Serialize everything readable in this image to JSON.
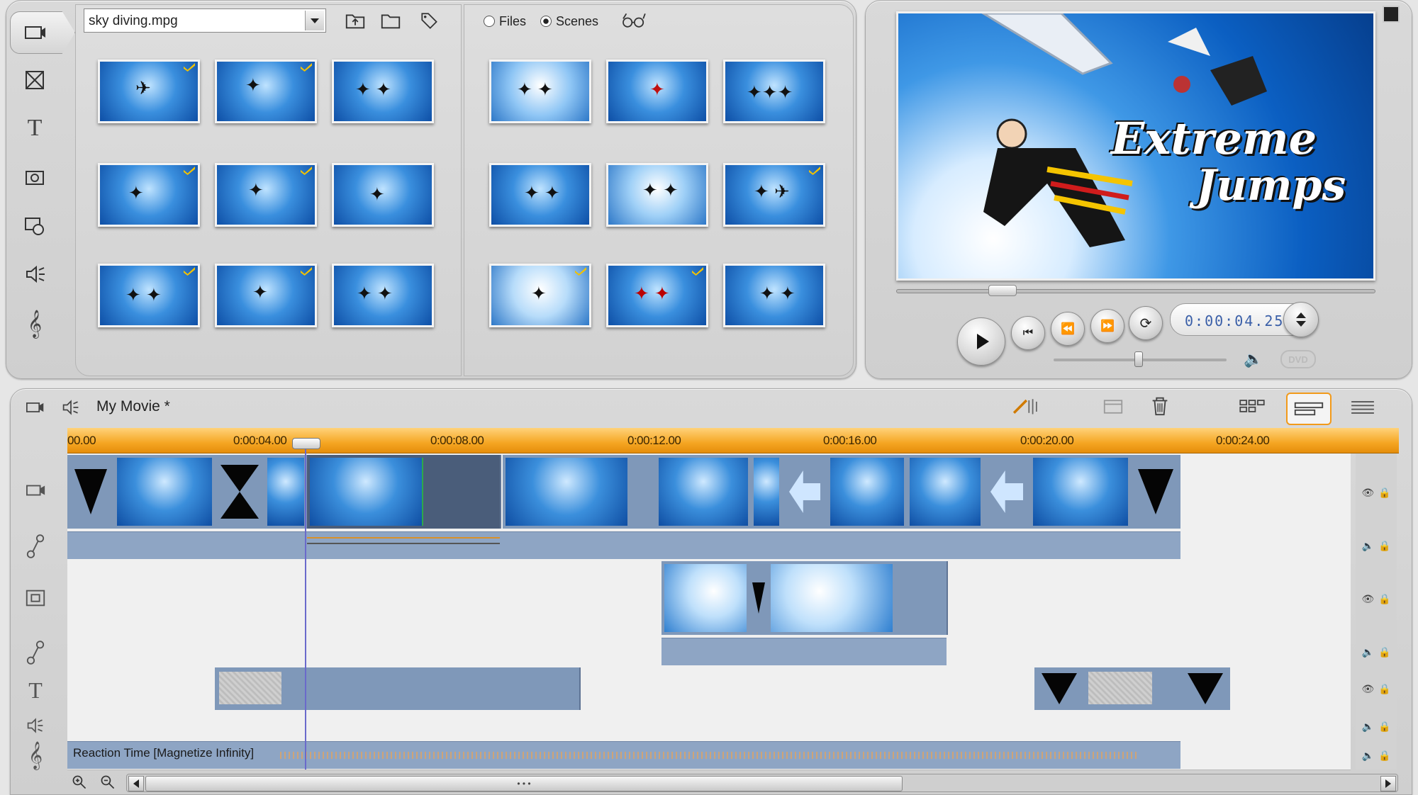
{
  "library": {
    "file_dropdown": "sky diving.mpg",
    "radio_files": "Files",
    "radio_scenes": "Scenes",
    "selected_mode": "Scenes",
    "sidebar_icons": [
      "video-library-icon",
      "transitions-icon",
      "title-icon",
      "photo-icon",
      "disc-menu-icon",
      "sound-effects-icon",
      "music-icon"
    ]
  },
  "preview": {
    "title_line1": "Extreme",
    "title_line2": "Jumps",
    "timecode": "0:00:04.25",
    "dvd_label": "DVD",
    "scrub_position": 0.21,
    "volume_position": 0.6
  },
  "timeline": {
    "project_title": "My Movie *",
    "ruler_labels": [
      "00.00",
      "0:00:04.00",
      "0:00:08.00",
      "0:00:12.00",
      "0:00:16.00",
      "0:00:20.00",
      "0:00:24.00"
    ],
    "audio_clip_label": "Reaction Time [Magnetize Infinity]",
    "scrollbar_dots": "• • •"
  },
  "colors": {
    "ruler": "#f5a623",
    "clip": "#7f98b9",
    "playhead": "#6a6acb"
  }
}
